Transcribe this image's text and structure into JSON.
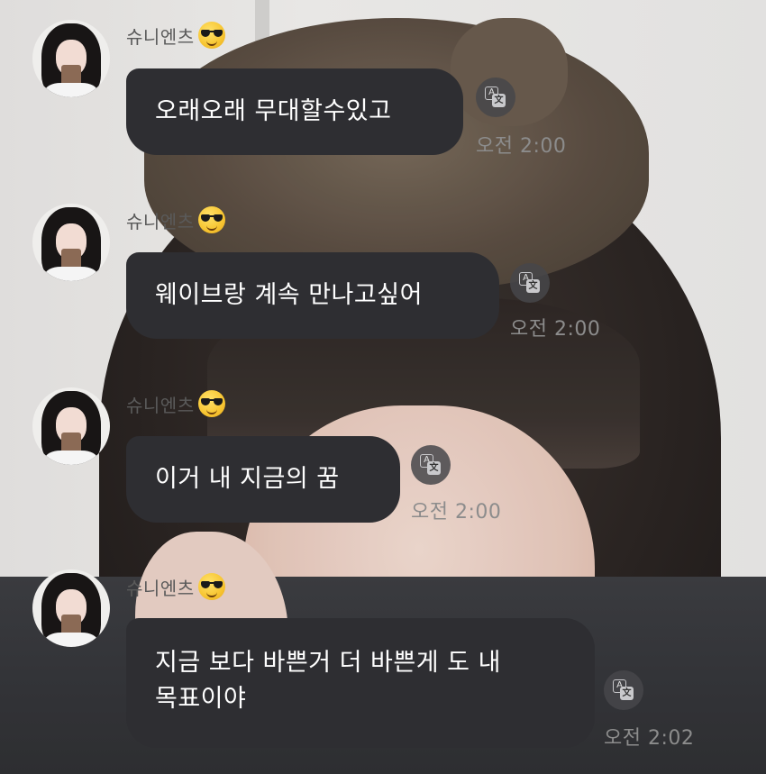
{
  "messages": [
    {
      "sender": "슈니엔츠",
      "emoji": "smiling-face-with-sunglasses-icon",
      "text": "오래오래 무대할수있고",
      "time": "오전 2:00"
    },
    {
      "sender": "슈니엔츠",
      "emoji": "smiling-face-with-sunglasses-icon",
      "text": "웨이브랑 계속 만나고싶어",
      "time": "오전 2:00"
    },
    {
      "sender": "슈니엔츠",
      "emoji": "smiling-face-with-sunglasses-icon",
      "text": "이거 내 지금의 꿈",
      "time": "오전 2:00"
    },
    {
      "sender": "슈니엔츠",
      "emoji": "smiling-face-with-sunglasses-icon",
      "text_lines": [
        "지금 보다 바쁜거 더 바쁜게 도 내",
        "목표이야"
      ],
      "time": "오전 2:02"
    }
  ],
  "colors": {
    "bubble": "#2e2e32",
    "bubble_text": "#ffffff",
    "name_text": "#5a5a5a",
    "time_text": "#8c8c8c"
  },
  "icons": {
    "translate": "translate-icon",
    "translate_glyph_a": "A",
    "translate_glyph_x": "文"
  }
}
